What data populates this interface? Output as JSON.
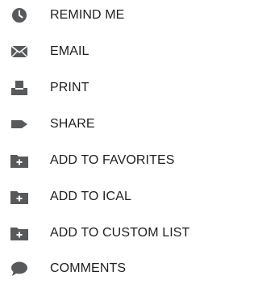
{
  "colors": {
    "icon": "#58595b",
    "text": "#1f1f1f",
    "background": "#ffffff"
  },
  "menu": {
    "items": [
      {
        "label": "REMIND ME",
        "icon": "clock-icon"
      },
      {
        "label": "EMAIL",
        "icon": "envelope-icon"
      },
      {
        "label": "PRINT",
        "icon": "printer-icon"
      },
      {
        "label": "SHARE",
        "icon": "share-arrow-icon"
      },
      {
        "label": "ADD TO FAVORITES",
        "icon": "folder-plus-icon"
      },
      {
        "label": "ADD TO ICAL",
        "icon": "folder-plus-icon"
      },
      {
        "label": "ADD TO CUSTOM LIST",
        "icon": "folder-plus-icon"
      },
      {
        "label": "COMMENTS",
        "icon": "speech-bubble-icon"
      }
    ]
  }
}
